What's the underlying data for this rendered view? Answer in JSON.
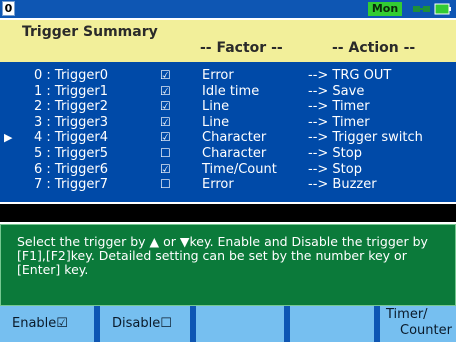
{
  "status": {
    "channel": "0",
    "mode": "Mon"
  },
  "summary": {
    "title": "Trigger Summary",
    "col_factor": "-- Factor --",
    "col_action": "-- Action --",
    "rows": [
      {
        "pointer": "",
        "trigger": "0 : Trigger0",
        "checked": "☑",
        "factor": "Error",
        "action": "--> TRG OUT"
      },
      {
        "pointer": "",
        "trigger": "1 : Trigger1",
        "checked": "☑",
        "factor": "Idle time",
        "action": "--> Save"
      },
      {
        "pointer": "",
        "trigger": "2 : Trigger2",
        "checked": "☑",
        "factor": "Line",
        "action": "--> Timer"
      },
      {
        "pointer": "",
        "trigger": "3 : Trigger3",
        "checked": "☑",
        "factor": "Line",
        "action": "--> Timer"
      },
      {
        "pointer": "▶",
        "trigger": "4 : Trigger4",
        "checked": "☑",
        "factor": "Character",
        "action": "--> Trigger switch"
      },
      {
        "pointer": "",
        "trigger": "5 : Trigger5",
        "checked": "☐",
        "factor": "Character",
        "action": "--> Stop"
      },
      {
        "pointer": "",
        "trigger": "6 : Trigger6",
        "checked": "☑",
        "factor": "Time/Count",
        "action": "--> Stop"
      },
      {
        "pointer": "",
        "trigger": "7 : Trigger7",
        "checked": "☐",
        "factor": "Error",
        "action": "--> Buzzer"
      }
    ]
  },
  "message": "Select the trigger by ▲ or ▼key. Enable and Disable the trigger by [F1],[F2]key. Detailed setting can be set by the number key or [Enter] key.",
  "fkeys": {
    "f1": "Enable☑",
    "f2": "Disable☐",
    "f3": "",
    "f4": "",
    "f5_line1": "Timer/",
    "f5_line2": "Counter"
  },
  "colors": {
    "panel_blue": "#004aa8",
    "header_yellow": "#f2ef9a",
    "message_green": "#0b7a3a",
    "fkey_blue": "#76bff0",
    "mon_green": "#33cc33"
  }
}
